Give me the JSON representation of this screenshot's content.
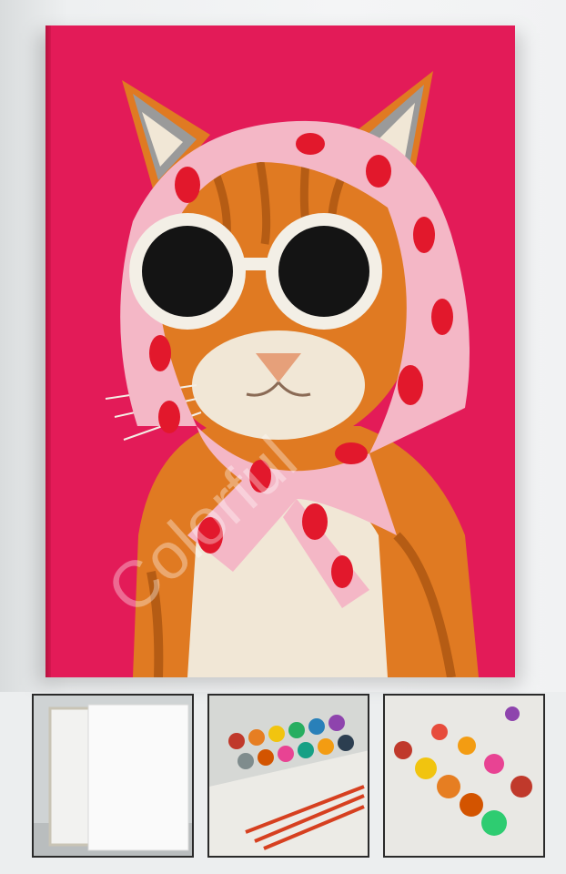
{
  "main_image": {
    "subject": "cat-with-sunglasses-and-headscarf",
    "watermark_text": "Colorful"
  },
  "thumbnails": [
    {
      "name": "blank-canvas"
    },
    {
      "name": "paint-pots-and-brushes"
    },
    {
      "name": "open-paint-pots"
    }
  ],
  "colors": {
    "background_pink": "#e31b58",
    "scarf_pink": "#f4b7c6",
    "scarf_dots": "#e2182c",
    "fur_orange": "#e07a22",
    "fur_cream": "#f1e7d6",
    "lens_black": "#141414"
  }
}
